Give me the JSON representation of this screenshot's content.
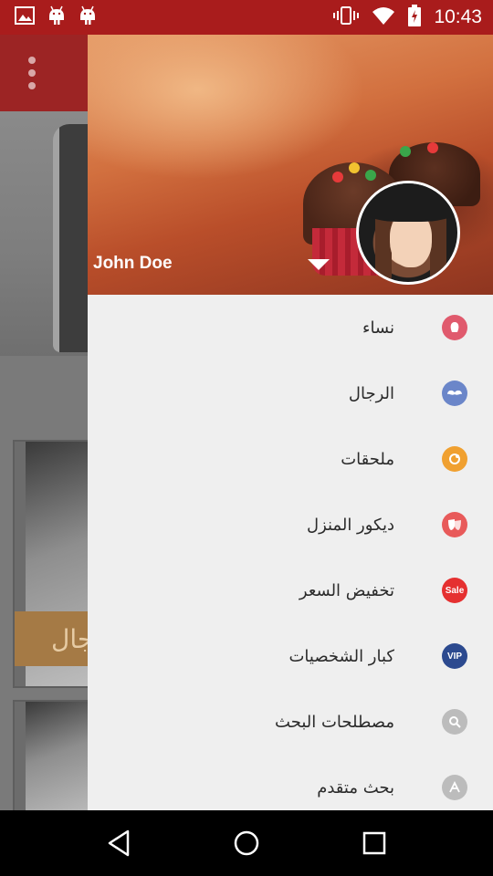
{
  "status_bar": {
    "time": "10:43",
    "background": "#a91c1c",
    "left_icons": [
      "image-icon",
      "android-icon",
      "android-icon"
    ],
    "right_icons": [
      "vibrate-icon",
      "wifi-icon",
      "battery-icon"
    ]
  },
  "toolbar": {
    "background": "#9c2424",
    "overflow_icon": "more-vertical-icon"
  },
  "background_content": {
    "card_label": "رجال"
  },
  "drawer": {
    "user": {
      "name": "John Doe"
    },
    "menu": [
      {
        "label": "نساء",
        "icon": "women-icon",
        "icon_color": "#e05a6d"
      },
      {
        "label": "الرجال",
        "icon": "mustache-icon",
        "icon_color": "#6b86c9"
      },
      {
        "label": "ملحقات",
        "icon": "accessories-icon",
        "icon_color": "#f0a030"
      },
      {
        "label": "ديكور المنزل",
        "icon": "masks-icon",
        "icon_color": "#e85a5a"
      },
      {
        "label": "تخفيض السعر",
        "icon": "sale-icon",
        "icon_color": "#e53030",
        "icon_text": "Sale"
      },
      {
        "label": "كبار الشخصيات",
        "icon": "vip-icon",
        "icon_color": "#2c4a8f",
        "icon_text": "VIP"
      },
      {
        "label": "مصطلحات البحث",
        "icon": "search-icon",
        "icon_color": "#bcbcbc"
      },
      {
        "label": "بحث متقدم",
        "icon": "advanced-search-icon",
        "icon_color": "#bcbcbc"
      }
    ]
  },
  "nav_bar": {
    "buttons": [
      "back-icon",
      "home-icon",
      "recents-icon"
    ]
  }
}
